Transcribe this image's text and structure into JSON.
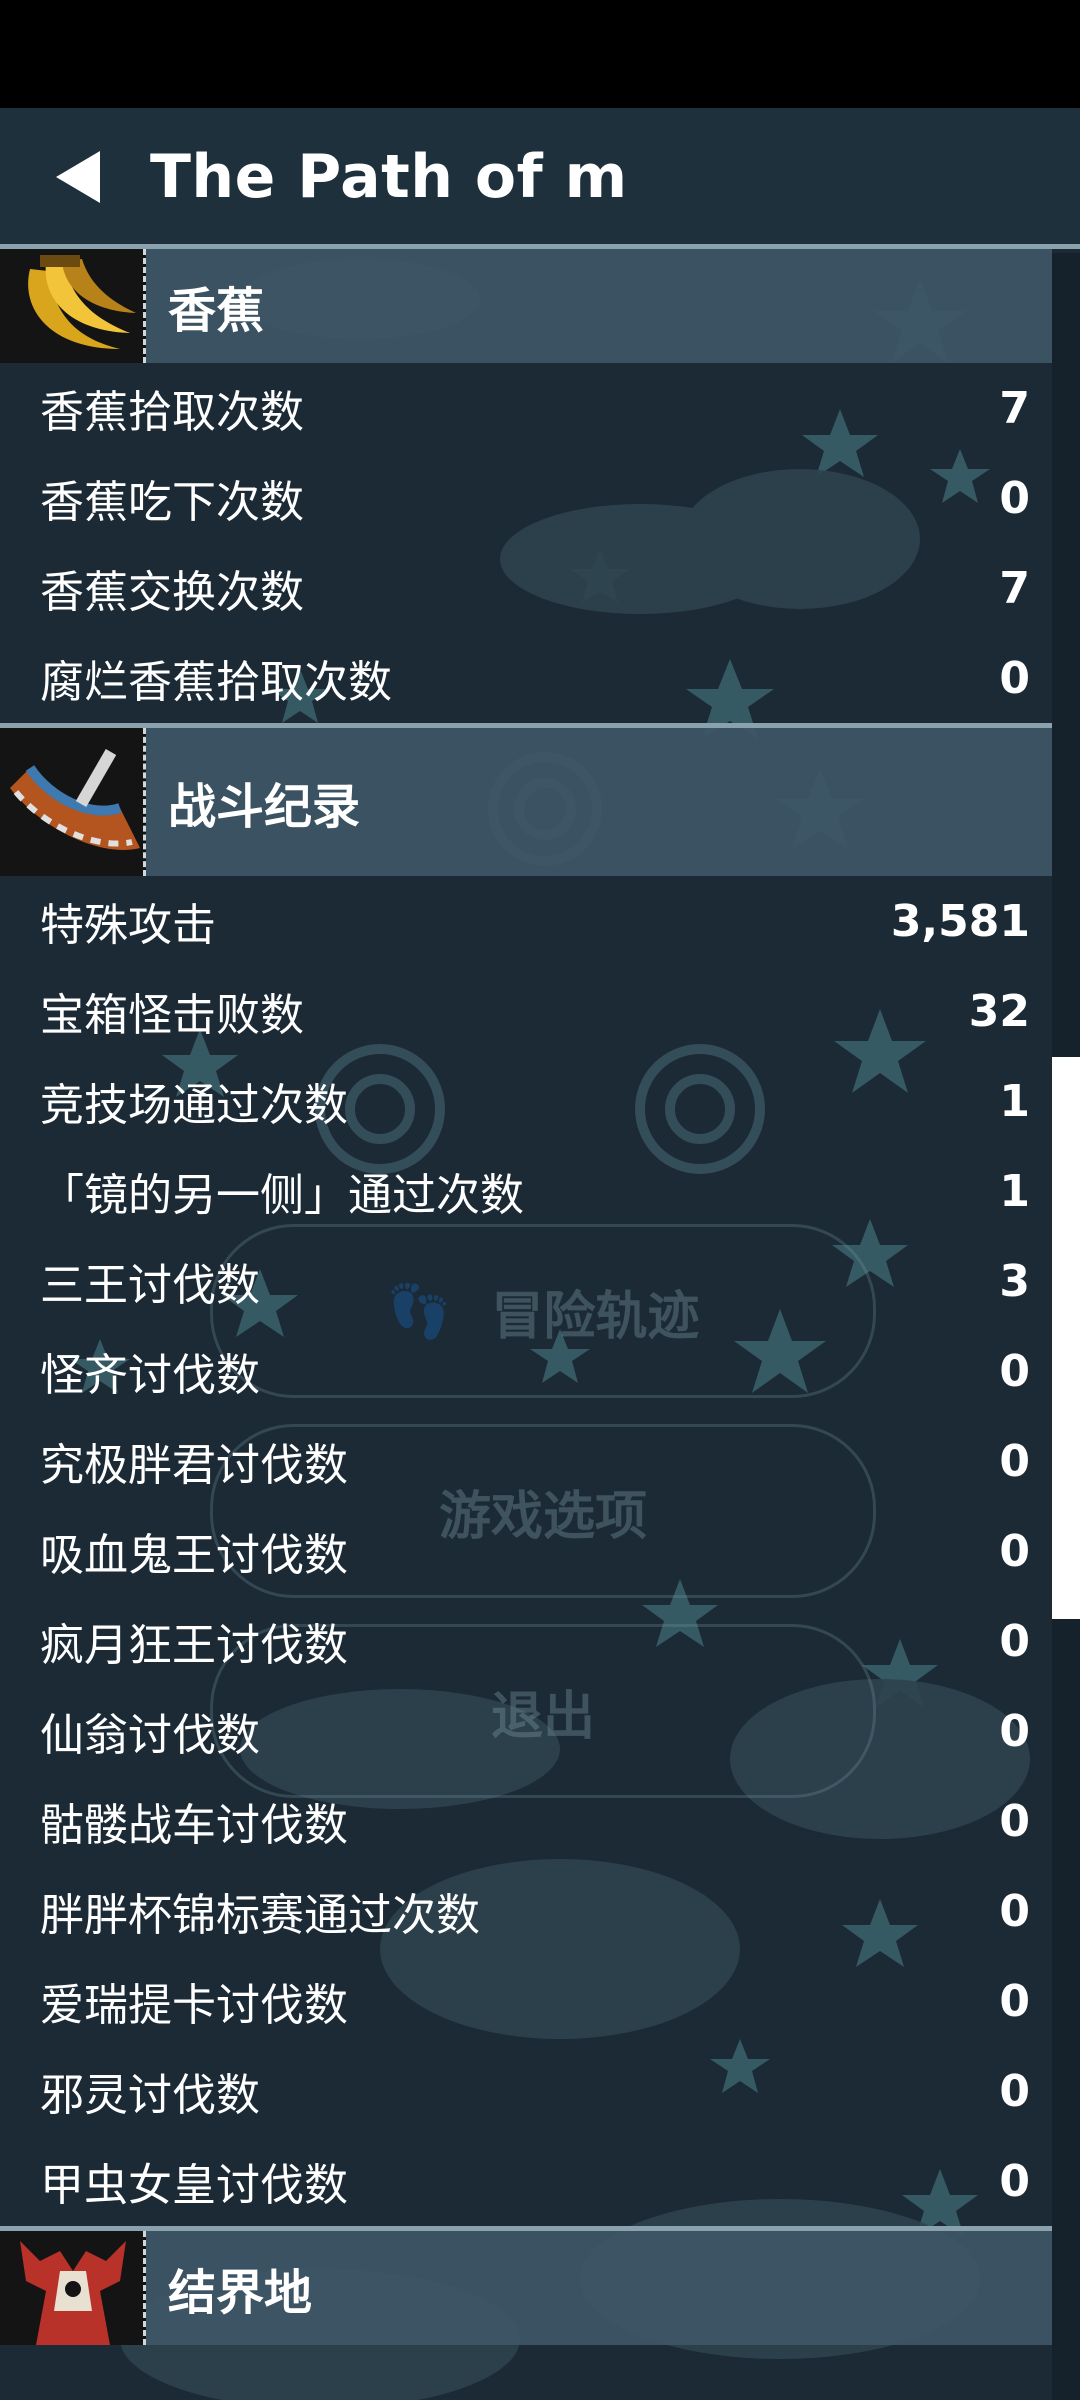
{
  "header": {
    "title": "The Path of m"
  },
  "background_menu": {
    "items": [
      "冒险轨迹",
      "游戏选项",
      "退出"
    ]
  },
  "sections": [
    {
      "title": "香蕉",
      "icon": "banana-icon",
      "rows": [
        {
          "label": "香蕉拾取次数",
          "value": "7"
        },
        {
          "label": "香蕉吃下次数",
          "value": "0"
        },
        {
          "label": "香蕉交换次数",
          "value": "7"
        },
        {
          "label": "腐烂香蕉拾取次数",
          "value": "0"
        }
      ]
    },
    {
      "title": "战斗纪录",
      "icon": "battle-weapon-icon",
      "rows": [
        {
          "label": "特殊攻击",
          "value": "3,581"
        },
        {
          "label": "宝箱怪击败数",
          "value": "32"
        },
        {
          "label": "竞技场通过次数",
          "value": "1"
        },
        {
          "label": "「镜的另一侧」通过次数",
          "value": "1"
        },
        {
          "label": "三王讨伐数",
          "value": "3"
        },
        {
          "label": "怪齐讨伐数",
          "value": "0"
        },
        {
          "label": "究极胖君讨伐数",
          "value": "0"
        },
        {
          "label": "吸血鬼王讨伐数",
          "value": "0"
        },
        {
          "label": "疯月狂王讨伐数",
          "value": "0"
        },
        {
          "label": "仙翁讨伐数",
          "value": "0"
        },
        {
          "label": "骷髅战车讨伐数",
          "value": "0"
        },
        {
          "label": "胖胖杯锦标赛通过次数",
          "value": "0"
        },
        {
          "label": "爱瑞提卡讨伐数",
          "value": "0"
        },
        {
          "label": "邪灵讨伐数",
          "value": "0"
        },
        {
          "label": "甲虫女皇讨伐数",
          "value": "0"
        }
      ]
    },
    {
      "title": "结界地",
      "icon": "barrier-totem-icon",
      "rows": []
    }
  ],
  "scrollbar": {
    "position_fraction": 0.38,
    "thumb_fraction": 0.26
  }
}
